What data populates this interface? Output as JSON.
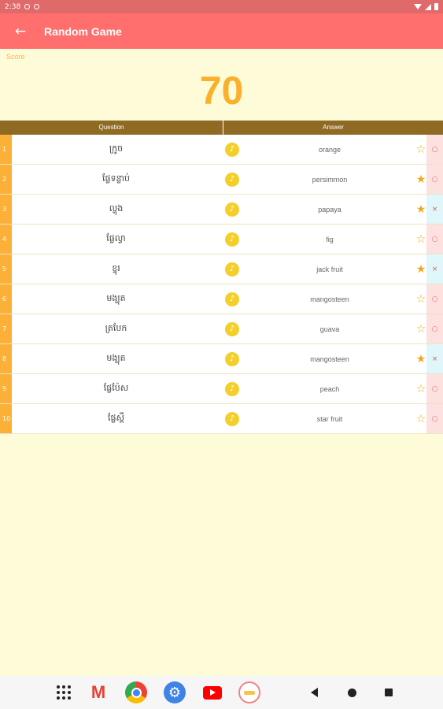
{
  "status_bar": {
    "time": "2:38"
  },
  "app_bar": {
    "back_glyph": "←",
    "title": "Random Game"
  },
  "score": {
    "label": "Score",
    "value": "70"
  },
  "table": {
    "headers": {
      "question": "Question",
      "answer": "Answer"
    },
    "rows": [
      {
        "num": "1",
        "question": "ក្រូច",
        "answer": "orange",
        "starred": false,
        "result": "correct"
      },
      {
        "num": "2",
        "question": "ផ្លែទន្លាប់",
        "answer": "persimmon",
        "starred": true,
        "result": "correct"
      },
      {
        "num": "3",
        "question": "ល្ហុង",
        "answer": "papaya",
        "starred": true,
        "result": "wrong"
      },
      {
        "num": "4",
        "question": "ផ្លែល្វា",
        "answer": "fig",
        "starred": false,
        "result": "correct"
      },
      {
        "num": "5",
        "question": "ខ្នុរ",
        "answer": "jack fruit",
        "starred": true,
        "result": "wrong"
      },
      {
        "num": "6",
        "question": "មង្ឃុត",
        "answer": "mangosteen",
        "starred": false,
        "result": "correct"
      },
      {
        "num": "7",
        "question": "ត្របែក",
        "answer": "guava",
        "starred": false,
        "result": "correct"
      },
      {
        "num": "8",
        "question": "មង្ឃុត",
        "answer": "mangosteen",
        "starred": true,
        "result": "wrong"
      },
      {
        "num": "9",
        "question": "ផ្លែប៉ែស",
        "answer": "peach",
        "starred": false,
        "result": "correct"
      },
      {
        "num": "10",
        "question": "ផ្លែស្ពឺ",
        "answer": "star fruit",
        "starred": false,
        "result": "correct"
      }
    ]
  },
  "symbols": {
    "play": "♪",
    "star_filled": "★",
    "star_empty": "☆",
    "correct": "○",
    "wrong": "×"
  },
  "nav_bar": {
    "apps": [
      "app-grid-icon",
      "gmail-icon",
      "chrome-icon",
      "settings-icon",
      "youtube-icon",
      "app-icon"
    ],
    "gmail_glyph": "M",
    "settings_glyph": "⚙"
  },
  "colors": {
    "app_bar": "#fe6f6d",
    "background": "#fefbd8",
    "score": "#fbb02b",
    "header": "#8e6a23",
    "row_number": "#fcb038",
    "play_button": "#f4cf2a",
    "star": "#f1a81c",
    "correct_bg": "#fde1e1",
    "wrong_bg": "#dff6fb"
  }
}
